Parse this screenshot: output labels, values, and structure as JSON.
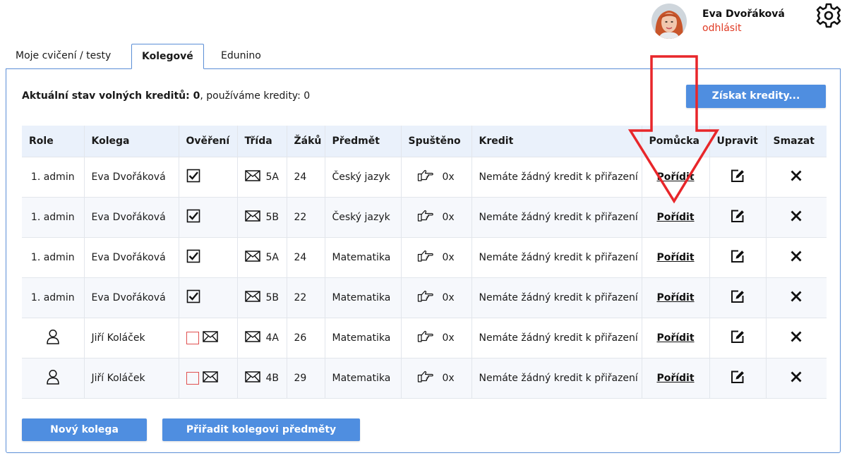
{
  "user": {
    "name": "Eva Dvořáková",
    "logout_label": "odhlásit"
  },
  "tabs": [
    {
      "label": "Moje cvičení / testy",
      "active": false
    },
    {
      "label": "Kolegové",
      "active": true
    },
    {
      "label": "Edunino",
      "active": false
    }
  ],
  "credits": {
    "label_bold": "Aktuální stav volných kreditů: 0",
    "label_rest": ", používáme kredity: 0",
    "get_button": "Získat kredity..."
  },
  "table": {
    "headers": [
      "Role",
      "Kolega",
      "Ověření",
      "Třída",
      "Žáků",
      "Předmět",
      "Spuštěno",
      "Kredit",
      "Pomůcka",
      "Upravit",
      "Smazat"
    ],
    "rows": [
      {
        "role": "1. admin",
        "colleague": "Eva Dvořáková",
        "verified": true,
        "class": "5A",
        "pupils": "24",
        "subject": "Český jazyk",
        "started": "0x",
        "credit": "Nemáte žádný kredit k přiřazení",
        "aid": "Pořídit"
      },
      {
        "role": "1. admin",
        "colleague": "Eva Dvořáková",
        "verified": true,
        "class": "5B",
        "pupils": "22",
        "subject": "Český jazyk",
        "started": "0x",
        "credit": "Nemáte žádný kredit k přiřazení",
        "aid": "Pořídit"
      },
      {
        "role": "1. admin",
        "colleague": "Eva Dvořáková",
        "verified": true,
        "class": "5A",
        "pupils": "24",
        "subject": "Matematika",
        "started": "0x",
        "credit": "Nemáte žádný kredit k přiřazení",
        "aid": "Pořídit"
      },
      {
        "role": "1. admin",
        "colleague": "Eva Dvořáková",
        "verified": true,
        "class": "5B",
        "pupils": "22",
        "subject": "Matematika",
        "started": "0x",
        "credit": "Nemáte žádný kredit k přiřazení",
        "aid": "Pořídit"
      },
      {
        "role": "",
        "colleague": "Jiří Koláček",
        "verified": false,
        "class": "4A",
        "pupils": "26",
        "subject": "Matematika",
        "started": "0x",
        "credit": "Nemáte žádný kredit k přiřazení",
        "aid": "Pořídit"
      },
      {
        "role": "",
        "colleague": "Jiří Koláček",
        "verified": false,
        "class": "4B",
        "pupils": "29",
        "subject": "Matematika",
        "started": "0x",
        "credit": "Nemáte žádný kredit k přiřazení",
        "aid": "Pořídit"
      }
    ]
  },
  "buttons": {
    "new_colleague": "Nový kolega",
    "assign_subjects": "Přiřadit kolegovi předměty"
  },
  "icons": {
    "gear": "gear-icon",
    "checkbox": "checkbox-checked-icon",
    "envelope": "envelope-icon",
    "pointer": "pointing-hand-icon",
    "edit": "edit-icon",
    "delete": "close-icon",
    "user": "user-icon"
  },
  "colors": {
    "accent": "#4f8ee0",
    "logout": "#e03a24",
    "arrow": "#e8262a",
    "header_bg": "#eaf1fb"
  }
}
